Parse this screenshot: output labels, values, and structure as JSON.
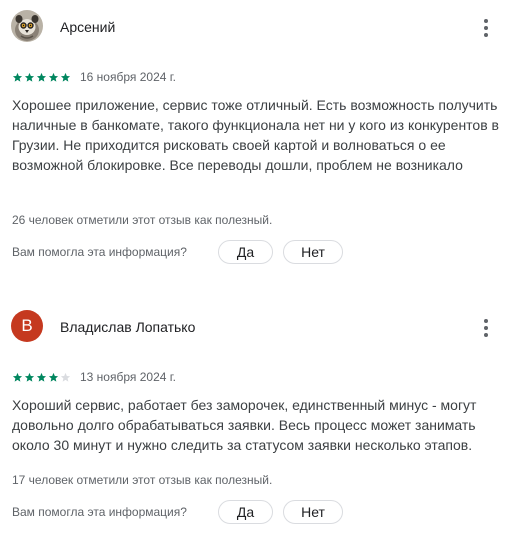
{
  "reviews": [
    {
      "author": "Арсений",
      "avatar_icon": "lemur-photo-avatar",
      "rating": 5,
      "max_rating": 5,
      "date": "16 ноября 2024 г.",
      "text": "Хорошее приложение, сервис тоже отличный. Есть возможность получить наличные в банкомате, такого функционала нет ни у кого из конкурентов в Грузии. Не приходится рисковать своей картой и волноваться о ее возможной блокировке. Все переводы дошли, проблем не возникало",
      "helpful_text": "26 человек отметили этот отзыв как полезный.",
      "question": "Вам помогла эта информация?",
      "yes_label": "Да",
      "no_label": "Нет"
    },
    {
      "author": "Владислав Лопатько",
      "avatar_letter": "В",
      "avatar_color": "#c5391f",
      "rating": 4,
      "max_rating": 5,
      "date": "13 ноября 2024 г.",
      "text": "Хороший сервис, работает без заморочек, единственный минус - могут довольно долго обрабатываться заявки. Весь процесс может занимать около 30 минут и нужно следить за статусом заявки несколько этапов.",
      "helpful_text": "17 человек отметили этот отзыв как полезный.",
      "question": "Вам помогла эта информация?",
      "yes_label": "Да",
      "no_label": "Нет"
    }
  ],
  "colors": {
    "star_filled": "#01875f",
    "star_empty": "#dadce0"
  }
}
